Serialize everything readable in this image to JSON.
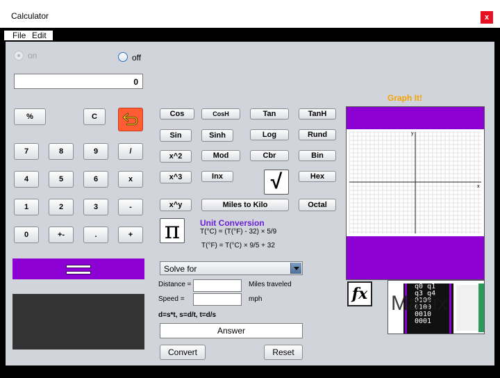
{
  "window": {
    "title": "Calculator",
    "close_glyph": "x"
  },
  "menu": {
    "file": "File",
    "edit": "Edit"
  },
  "power": {
    "on_label": "on",
    "off_label": "off",
    "selected": "off"
  },
  "display": {
    "value": "0"
  },
  "keypad": {
    "percent": "%",
    "clear": "C",
    "undo_icon": "undo-arrow-icon",
    "rows": [
      [
        "7",
        "8",
        "9",
        "/"
      ],
      [
        "4",
        "5",
        "6",
        "x"
      ],
      [
        "1",
        "2",
        "3",
        "-"
      ],
      [
        "0",
        "+-",
        ".",
        "+"
      ]
    ],
    "equals_glyph": "=",
    "equals_color": "#8c00d4"
  },
  "sci": {
    "row1": [
      "Cos",
      "CosH",
      "Tan",
      "TanH"
    ],
    "row2": [
      "Sin",
      "Sinh",
      "Log",
      "Rund"
    ],
    "row3": [
      "x^2",
      "Mod",
      "Cbr",
      "Bin"
    ],
    "row4": [
      "x^3",
      "Inx",
      "Hex"
    ],
    "sqrt_glyph": "√",
    "row5": [
      "x^y",
      "Miles to Kilo",
      "Octal"
    ],
    "pi_glyph": "π"
  },
  "conversion": {
    "title": "Unit Conversion",
    "c_formula": "T(°C) = (T(°F) - 32) × 5/9",
    "f_formula": "T(°F) = T(°C) × 9/5 + 32"
  },
  "solver": {
    "select_value": "Solve for",
    "distance_label": "Distance =",
    "distance_unit": "Miles traveled",
    "speed_label": "Speed =",
    "speed_unit": "mph",
    "formula": "d=s*t, s=d/t, t=d/s",
    "answer": "Answer",
    "convert": "Convert",
    "reset": "Reset"
  },
  "graph": {
    "title": "Graph It!",
    "title_color": "#f5a300",
    "band_color": "#8c00d4",
    "x_axis_label": "x",
    "y_axis_label": "y"
  },
  "fx_glyph": "fx",
  "matrix": {
    "word": "Matrix",
    "digits": [
      "q0  q1",
      "q3  q4",
      "0100",
      "0100",
      "0010",
      "0001"
    ]
  }
}
